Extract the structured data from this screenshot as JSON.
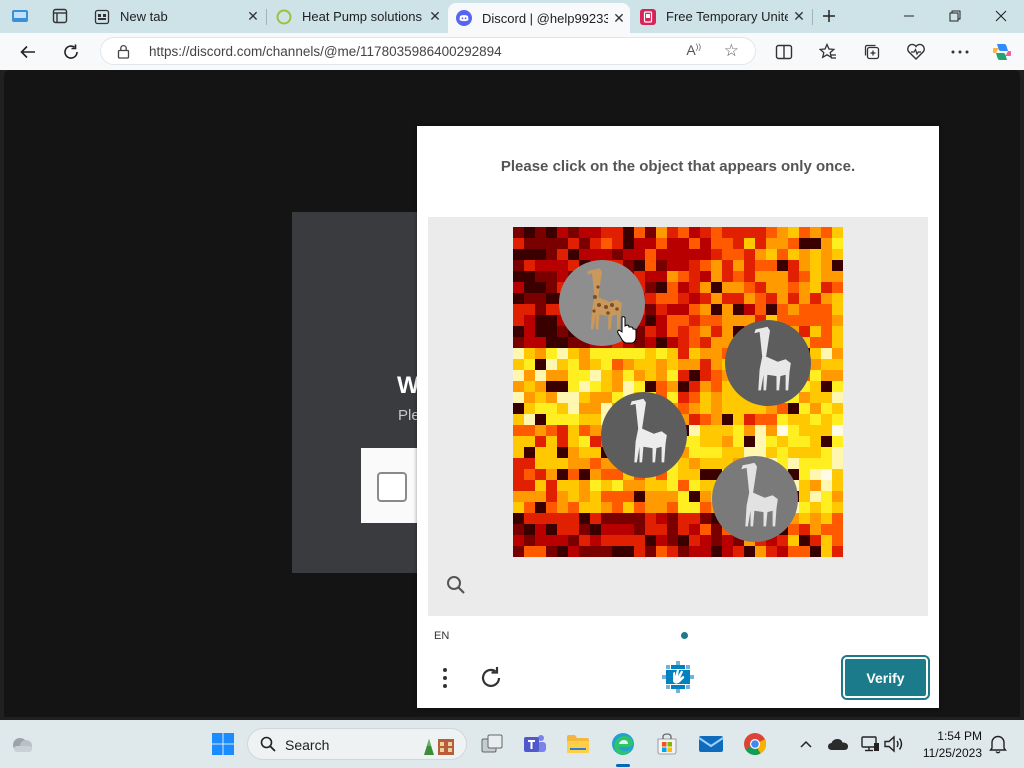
{
  "browser": {
    "tabs": [
      {
        "title": "New tab",
        "active": false
      },
      {
        "title": "Heat Pump solutions",
        "active": false
      },
      {
        "title": "Discord | @help99233",
        "active": true
      },
      {
        "title": "Free Temporary Unite",
        "active": false
      }
    ],
    "url": "https://discord.com/channels/@me/1178035986400292894"
  },
  "background_page": {
    "heading_partial": "W",
    "subtext_partial": "Ple"
  },
  "captcha": {
    "prompt": "Please click on the object that appears only once.",
    "language": "EN",
    "verify_label": "Verify",
    "colors": {
      "accent": "#1b7b8a"
    }
  },
  "taskbar": {
    "search_label": "Search",
    "time": "1:54 PM",
    "date": "11/25/2023"
  }
}
